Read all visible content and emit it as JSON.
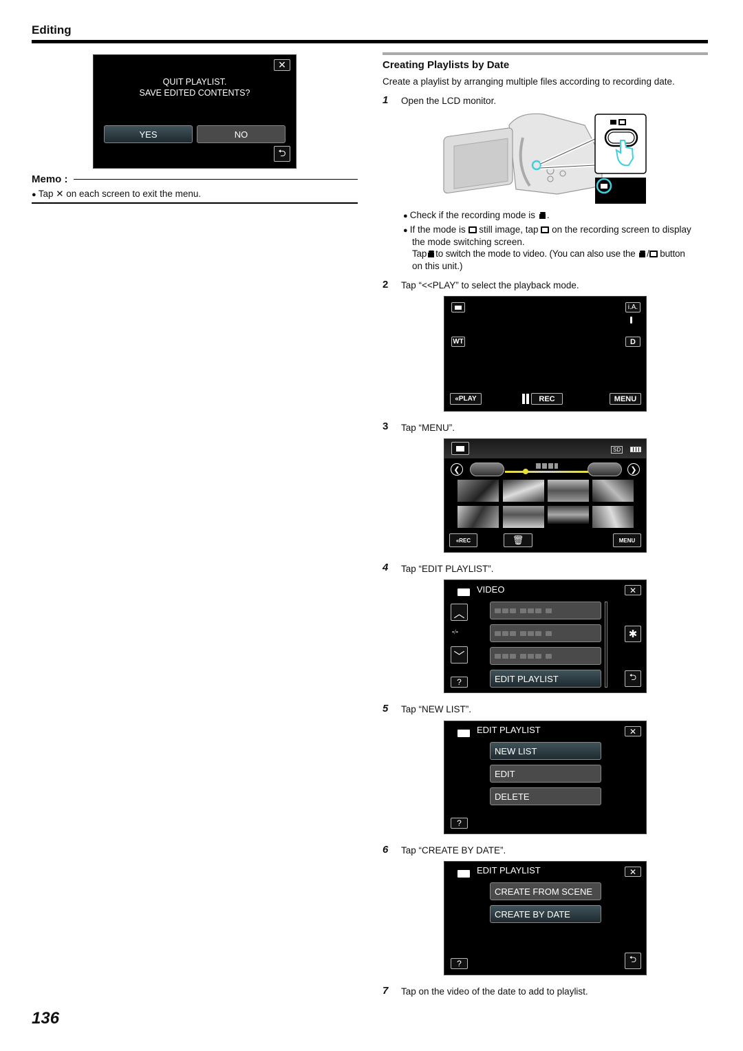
{
  "header": {
    "section": "Editing"
  },
  "quit_dialog": {
    "line1": "QUIT PLAYLIST.",
    "line2": "SAVE EDITED CONTENTS?",
    "yes_label": "YES",
    "no_label": "NO",
    "close_icon": "close-icon",
    "back_icon": "return-icon"
  },
  "memo": {
    "label": "Memo :",
    "bullet": "Tap ✕ on each screen to exit the menu."
  },
  "article": {
    "title": "Creating Playlists by Date",
    "intro": "Create a playlist by arranging multiple files according to recording date.",
    "steps": [
      {
        "num": "1",
        "text": "Open the LCD monitor."
      },
      {
        "num": "2",
        "text": "Tap “<<PLAY” to select the playback mode."
      },
      {
        "num": "3",
        "text": "Tap “MENU”."
      },
      {
        "num": "4",
        "text": "Tap “EDIT PLAYLIST”."
      },
      {
        "num": "5",
        "text": "Tap “NEW LIST”."
      },
      {
        "num": "6",
        "text": "Tap “CREATE BY DATE”."
      },
      {
        "num": "7",
        "text": "Tap on the video of the date to add to playlist."
      }
    ],
    "bullets": {
      "b1_pre": "Check if the recording mode is",
      "b1_post": ".",
      "b2_a": "If the mode is",
      "b2_b": "still image, tap",
      "b2_c": "on the recording screen to display",
      "b2_line2": "the mode switching screen.",
      "b2_line3_a": "Tap",
      "b2_line3_b": "to switch the mode to video. (You can also use the",
      "b2_line3_c": "button",
      "b2_line4": "on this unit.)",
      "slash": "/"
    }
  },
  "rec_screen": {
    "ia": "i.A.",
    "wt": "WT",
    "d": "D",
    "play": "«PLAY",
    "rec": "REC",
    "menu": "MENU"
  },
  "playback_screen": {
    "sd": "SD",
    "rec": "«REC",
    "menu": "MENU",
    "timeline_color": "#e8e030"
  },
  "video_menu": {
    "title": "VIDEO",
    "page": "▪/▪",
    "item_edit_playlist": "EDIT PLAYLIST",
    "help": "?"
  },
  "edit_playlist_menu": {
    "title": "EDIT PLAYLIST",
    "items": [
      "NEW LIST",
      "EDIT",
      "DELETE"
    ],
    "help": "?"
  },
  "create_menu": {
    "title": "EDIT PLAYLIST",
    "items": [
      "CREATE FROM SCENE",
      "CREATE BY DATE"
    ],
    "help": "?"
  },
  "camera_illustration": {
    "highlight_color": "#3fd0e0"
  },
  "page_number": "136"
}
